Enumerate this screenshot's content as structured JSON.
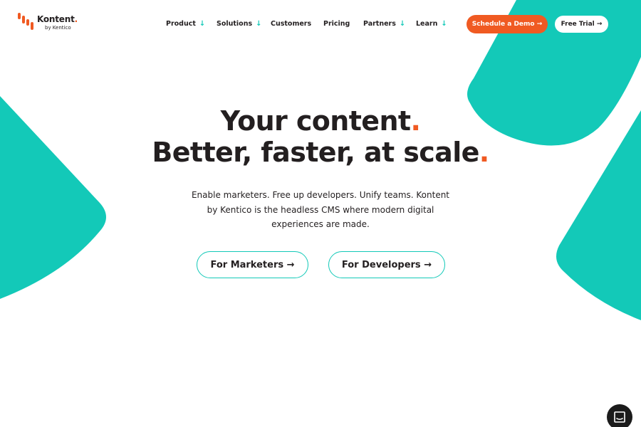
{
  "brand": {
    "name": "Kontent",
    "dot": ".",
    "sub": "by Kentico",
    "accent": "#f05a22",
    "teal": "#13c9b8",
    "dark": "#231f20"
  },
  "nav": {
    "items": [
      {
        "label": "Product",
        "has_dropdown": true,
        "arrow": "↓"
      },
      {
        "label": "Solutions",
        "has_dropdown": true,
        "arrow": "↓"
      },
      {
        "label": "Customers",
        "has_dropdown": false,
        "arrow": ""
      },
      {
        "label": "Pricing",
        "has_dropdown": false,
        "arrow": ""
      },
      {
        "label": "Partners",
        "has_dropdown": true,
        "arrow": "↓"
      },
      {
        "label": "Learn",
        "has_dropdown": true,
        "arrow": "↓"
      }
    ],
    "demo_label": "Schedule a Demo →",
    "trial_label": "Free Trial →"
  },
  "hero": {
    "line1": "Your content",
    "line2": "Better, faster, at scale",
    "dot": ".",
    "body": "Enable marketers. Free up developers. Unify teams. Kontent by Kentico is the headless CMS where modern digital experiences are made.",
    "cta_marketers": "For Marketers →",
    "cta_developers": "For Developers →"
  },
  "chat": {
    "icon": "chat-bubble-icon"
  }
}
